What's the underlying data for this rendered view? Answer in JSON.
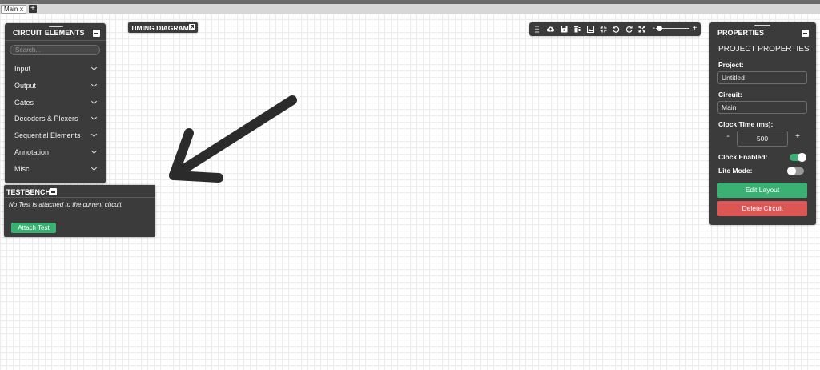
{
  "tabs": [
    {
      "label": "Main",
      "close": "x"
    }
  ],
  "add_tab_label": "+",
  "circuit_elements": {
    "title": "CIRCUIT ELEMENTS",
    "search_placeholder": "Search...",
    "items": [
      {
        "label": "Input"
      },
      {
        "label": "Output"
      },
      {
        "label": "Gates"
      },
      {
        "label": "Decoders & Plexers"
      },
      {
        "label": "Sequential Elements"
      },
      {
        "label": "Annotation"
      },
      {
        "label": "Misc"
      }
    ]
  },
  "timing_diagram": {
    "title": "TIMING DIAGRAM"
  },
  "testbench": {
    "title": "TESTBENCH",
    "message": "No Test is attached to the current circuit",
    "attach_label": "Attach Test"
  },
  "toolbar": {
    "icons": [
      "drag-icon",
      "cloud-upload-icon",
      "save-icon",
      "delete-icon",
      "download-image-icon",
      "fit-center-icon",
      "undo-icon",
      "redo-icon",
      "fullscreen-icon"
    ],
    "zoom_minus": "-",
    "zoom_plus": "+",
    "zoom_level": 0.1
  },
  "properties": {
    "title": "PROPERTIES",
    "subtitle": "PROJECT PROPERTIES",
    "project_label": "Project:",
    "project_value": "Untitled",
    "circuit_label": "Circuit:",
    "circuit_value": "Main",
    "clock_time_label": "Clock Time (ms):",
    "clock_time_value": "500",
    "clock_minus": "-",
    "clock_plus": "+",
    "clock_enabled_label": "Clock Enabled:",
    "clock_enabled": true,
    "lite_mode_label": "Lite Mode:",
    "lite_mode": false,
    "edit_layout_label": "Edit Layout",
    "delete_circuit_label": "Delete Circuit"
  },
  "colors": {
    "panel": "#3b3b3b",
    "accent_green": "#3bb073",
    "danger_red": "#dc5656",
    "toggle_on": "#3bb073",
    "toggle_off": "#9a9a9a"
  }
}
